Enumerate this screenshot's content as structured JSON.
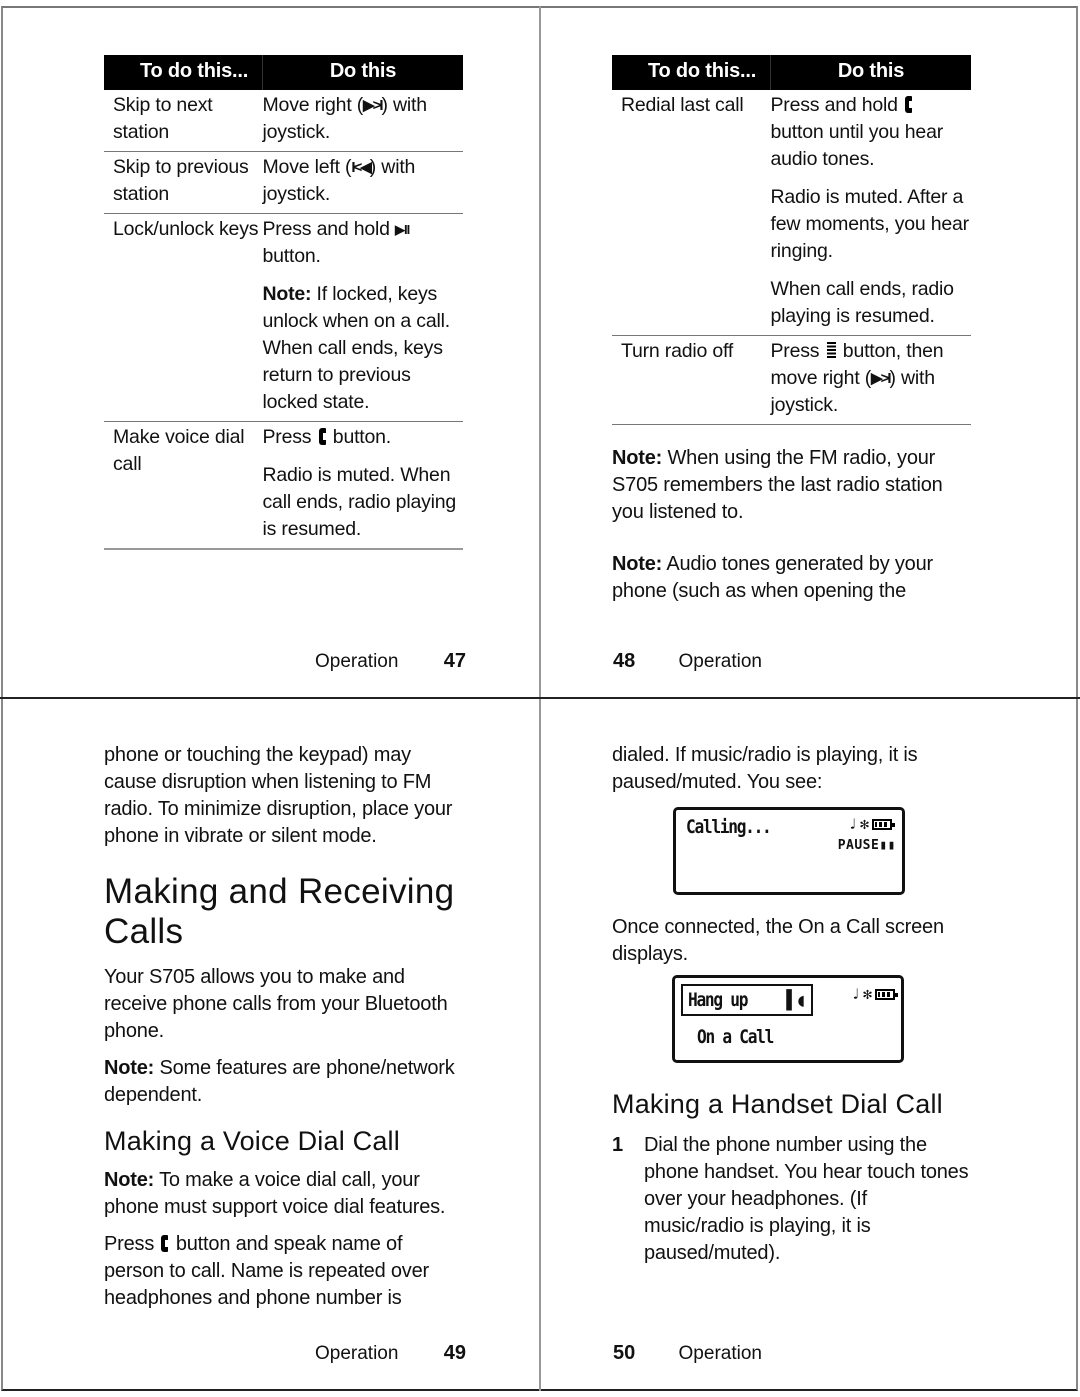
{
  "page47": {
    "table": {
      "headers": [
        "To do this...",
        "Do this"
      ],
      "rows": [
        {
          "task": "Skip to next station",
          "action_before": "Move right (",
          "icon": "next-track-icon",
          "icon_glyph": "▶>I",
          "action_after": ") with joystick.",
          "notes": []
        },
        {
          "task": "Skip to previous station",
          "action_before": "Move left (",
          "icon": "previous-track-icon",
          "icon_glyph": "I<◀",
          "action_after": ") with joystick.",
          "notes": []
        },
        {
          "task": "Lock/unlock keys",
          "action_before": "Press and hold ",
          "icon": "play-pause-icon",
          "icon_glyph": "▶II",
          "action_after": " button.",
          "notes": [
            {
              "label": "Note:",
              "text": " If locked, keys unlock when on a call. When call ends, keys return to previous locked state."
            }
          ]
        },
        {
          "task": "Make voice dial call",
          "action_before": "Press ",
          "icon": "call-button-icon",
          "icon_glyph": "",
          "action_after": " button.",
          "notes": [
            {
              "label": "",
              "text": "Radio is muted. When call ends, radio playing is resumed."
            }
          ]
        }
      ]
    },
    "footer": {
      "section": "Operation",
      "page": "47"
    }
  },
  "page48": {
    "table": {
      "headers": [
        "To do this...",
        "Do this"
      ],
      "rows": [
        {
          "task": "Redial last call",
          "action_before": "Press and hold ",
          "icon": "call-button-icon",
          "action_after": " button until you hear audio tones.",
          "notes": [
            "Radio is muted. After a few moments, you hear ringing.",
            "When call ends, radio playing is resumed."
          ]
        },
        {
          "task": "Turn radio off",
          "action_before": "Press ",
          "icon": "menu-button-icon",
          "action_mid": " button, then move right (",
          "icon2_glyph": "▶>I",
          "action_after": ") with joystick.",
          "notes": []
        }
      ]
    },
    "notes": [
      {
        "label": "Note:",
        "text": " When using the FM radio, your S705 remembers the last radio station you listened to."
      },
      {
        "label": "Note:",
        "text": " Audio tones generated by your phone (such as when opening the"
      }
    ],
    "footer": {
      "section": "Operation",
      "page": "48"
    }
  },
  "page49": {
    "intro": "phone or touching the keypad) may cause disruption when listening to FM radio. To minimize disruption, place your phone in vibrate or silent mode.",
    "heading": "Making and Receiving Calls",
    "para1": "Your S705 allows you to make and receive phone calls from your Bluetooth phone.",
    "note1": {
      "label": "Note:",
      "text": " Some features are phone/network dependent."
    },
    "subheading": "Making a Voice Dial Call",
    "note2": {
      "label": "Note:",
      "text": " To make a voice dial call, your phone must support voice dial features."
    },
    "para2_before": "Press ",
    "para2_after": " button and speak name of person to call. Name is repeated over headphones and phone number is",
    "footer": {
      "section": "Operation",
      "page": "49"
    }
  },
  "page50": {
    "intro": "dialed. If music/radio is playing, it is paused/muted. You see:",
    "screen1": {
      "title": "Calling...",
      "status_icons": [
        "music-note-icon",
        "bluetooth-icon",
        "battery-icon"
      ],
      "status_text": "PAUSE"
    },
    "mid_text": "Once connected, the On a Call screen displays.",
    "screen2": {
      "softkey": "Hang up",
      "title": "On a Call",
      "status_icons": [
        "music-note-icon",
        "bluetooth-icon",
        "battery-icon"
      ]
    },
    "subheading": "Making a Handset Dial Call",
    "steps": [
      {
        "num": "1",
        "text": "Dial the phone number using the phone handset. You hear touch tones over your headphones. (If music/radio is playing, it is paused/muted)."
      }
    ],
    "footer": {
      "section": "Operation",
      "page": "50"
    }
  }
}
